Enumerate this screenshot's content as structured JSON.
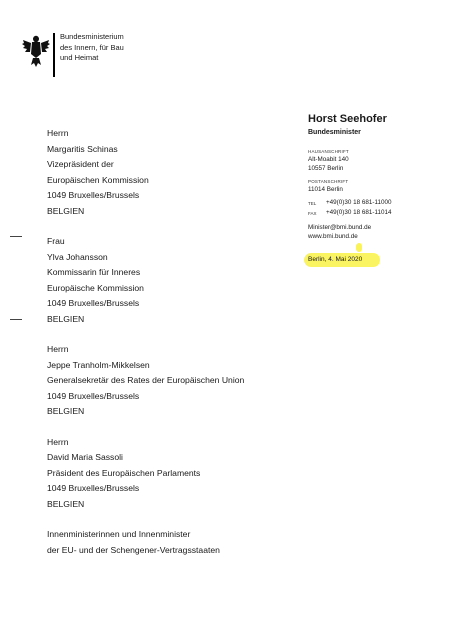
{
  "ministry": {
    "lines": [
      "Bundesministerium",
      "des Innern, für Bau",
      "und Heimat"
    ]
  },
  "sender": {
    "name": "Horst Seehofer",
    "role": "Bundesminister",
    "house_label": "HAUSANSCHRIFT",
    "house_lines": [
      "Alt-Moabit 140",
      "10557 Berlin"
    ],
    "post_label": "POSTANSCHRIFT",
    "post_line": "11014 Berlin",
    "tel_label": "TEL",
    "tel": "+49(0)30 18 681-11000",
    "fax_label": "FAX",
    "fax": "+49(0)30 18 681-11014",
    "email": "Minister@bmi.bund.de",
    "web": "www.bmi.bund.de",
    "date": "Berlin, 4. Mai 2020",
    "highlight_color": "#fbf35a"
  },
  "recipients": [
    {
      "lines": [
        "Herrn",
        "Margaritis Schinas",
        "Vizepräsident der",
        "Europäischen Kommission",
        "1049 Bruxelles/Brussels",
        "BELGIEN"
      ]
    },
    {
      "lines": [
        "Frau",
        "Ylva Johansson",
        "Kommissarin für Inneres",
        "Europäische Kommission",
        "1049 Bruxelles/Brussels",
        "BELGIEN"
      ]
    },
    {
      "lines": [
        "Herrn",
        "Jeppe Tranholm-Mikkelsen",
        "Generalsekretär des Rates der Europäischen Union",
        "1049 Bruxelles/Brussels",
        "BELGIEN"
      ]
    },
    {
      "lines": [
        "Herrn",
        "David Maria Sassoli",
        "Präsident des Europäischen Parlaments",
        "1049 Bruxelles/Brussels",
        "BELGIEN"
      ]
    },
    {
      "lines": [
        "Innenministerinnen und Innenminister",
        "der EU- und der Schengener-Vertragsstaaten"
      ]
    }
  ]
}
